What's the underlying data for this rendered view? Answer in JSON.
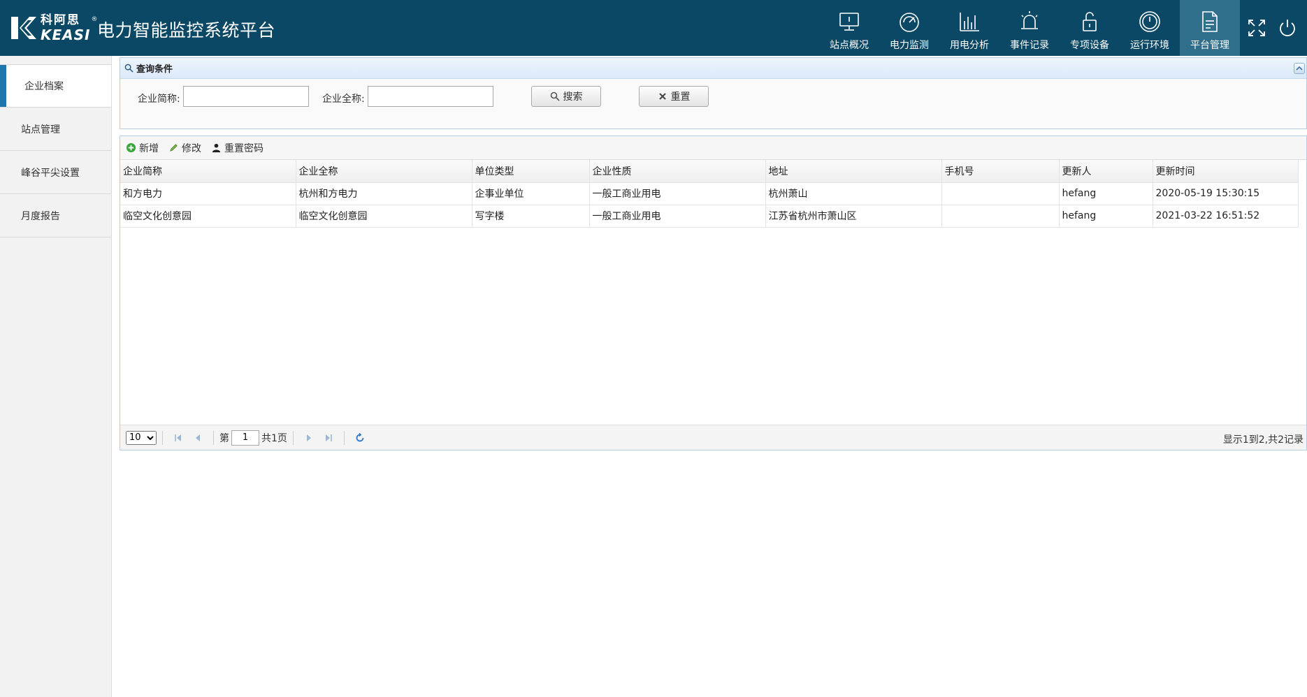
{
  "header": {
    "logo_cn": "科阿思",
    "logo_en": "KEASI",
    "logo_reg": "®",
    "title": "电力智能监控系统平台",
    "nav": [
      {
        "label": "站点概况",
        "icon": "monitor-icon"
      },
      {
        "label": "电力监测",
        "icon": "gauge-icon"
      },
      {
        "label": "用电分析",
        "icon": "bar-chart-icon"
      },
      {
        "label": "事件记录",
        "icon": "alarm-icon"
      },
      {
        "label": "专项设备",
        "icon": "lock-icon"
      },
      {
        "label": "运行环境",
        "icon": "clock-icon"
      },
      {
        "label": "平台管理",
        "icon": "document-icon"
      }
    ],
    "active_nav": "平台管理"
  },
  "sidebar": {
    "items": [
      {
        "label": "企业档案"
      },
      {
        "label": "站点管理"
      },
      {
        "label": "峰谷平尖设置"
      },
      {
        "label": "月度报告"
      }
    ],
    "active": "企业档案"
  },
  "query": {
    "title": "查询条件",
    "short_name_label": "企业简称:",
    "short_name_value": "",
    "full_name_label": "企业全称:",
    "full_name_value": "",
    "search_label": "搜索",
    "reset_label": "重置"
  },
  "toolbar": {
    "add_label": "新增",
    "edit_label": "修改",
    "reset_pwd_label": "重置密码"
  },
  "table": {
    "columns": [
      "企业简称",
      "企业全称",
      "单位类型",
      "企业性质",
      "地址",
      "手机号",
      "更新人",
      "更新时间"
    ],
    "rows": [
      [
        "和方电力",
        "杭州和方电力",
        "企事业单位",
        "一般工商业用电",
        "杭州萧山",
        "",
        "hefang",
        "2020-05-19 15:30:15"
      ],
      [
        "临空文化创意园",
        "临空文化创意园",
        "写字楼",
        "一般工商业用电",
        "江苏省杭州市萧山区",
        "",
        "hefang",
        "2021-03-22 16:51:52"
      ]
    ]
  },
  "pager": {
    "page_size": "10",
    "page_prefix": "第",
    "page_value": "1",
    "page_total": "共1页",
    "info": "显示1到2,共2记录"
  },
  "colors": {
    "header_bg": "#0b4865",
    "nav_active": "#2f6f8c",
    "sidebar_accent": "#1d77ad"
  }
}
